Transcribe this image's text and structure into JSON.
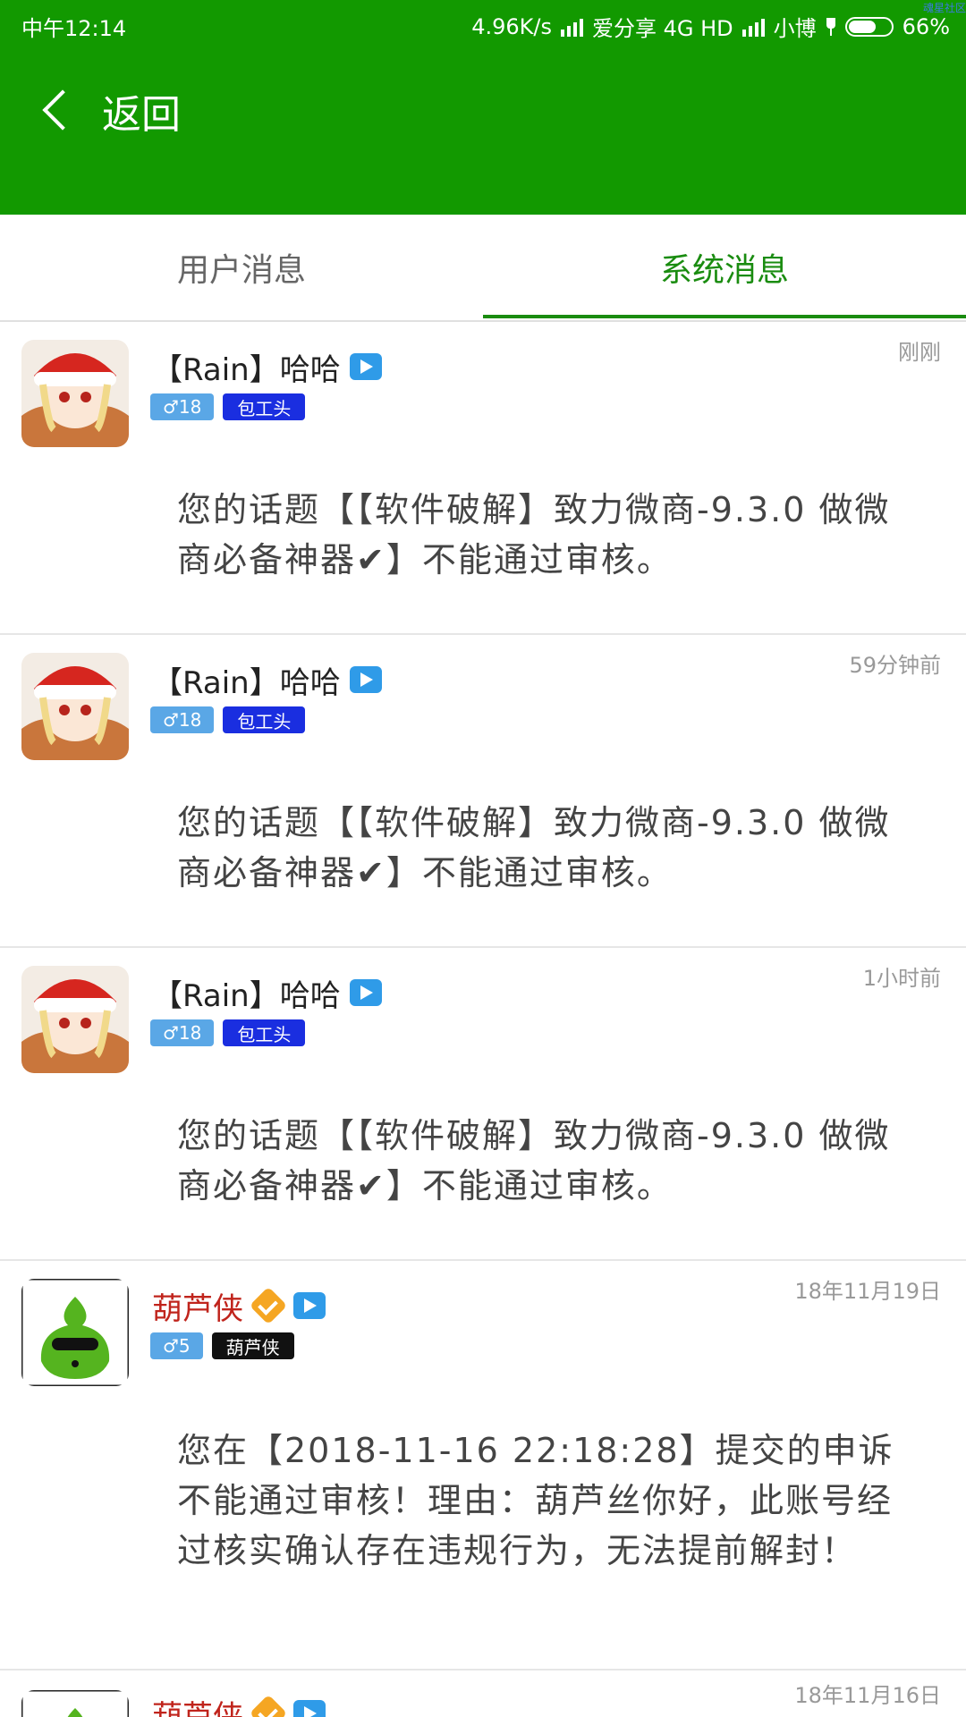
{
  "status_bar": {
    "time": "中午12:14",
    "net_speed": "4.96K/s",
    "carrier1": "爱分享 4G HD",
    "carrier2": "小博",
    "battery": "66%",
    "battery_level": 0.66
  },
  "watermark": "魂星社区",
  "header": {
    "back_label": "返回"
  },
  "tabs": [
    {
      "label": "用户消息",
      "active": false
    },
    {
      "label": "系统消息",
      "active": true
    }
  ],
  "messages": [
    {
      "name": "【Rain】哈哈",
      "gender_level": "♂18",
      "title": "包工头",
      "time": "刚刚",
      "body": "您的话题【【软件破解】致力微商-9.3.0 做微商必备神器✔】不能通过审核。"
    },
    {
      "name": "【Rain】哈哈",
      "gender_level": "♂18",
      "title": "包工头",
      "time": "59分钟前",
      "body": "您的话题【【软件破解】致力微商-9.3.0 做微商必备神器✔】不能通过审核。"
    },
    {
      "name": "【Rain】哈哈",
      "gender_level": "♂18",
      "title": "包工头",
      "time": "1小时前",
      "body": "您的话题【【软件破解】致力微商-9.3.0 做微商必备神器✔】不能通过审核。"
    },
    {
      "name": "葫芦侠",
      "gender_level": "♂5",
      "title": "葫芦侠",
      "time": "18年11月19日",
      "body": "您在【2018-11-16 22:18:28】提交的申诉不能通过审核！理由：葫芦丝你好，此账号经过核实确认存在违规行为，无法提前解封！"
    },
    {
      "name": "葫芦侠",
      "time": "18年11月16日"
    }
  ],
  "colors": {
    "header_green": "#129900",
    "active_tab_green": "#1a8c10",
    "badge_blue": "#1a2ee0",
    "video_blue": "#2f9be8",
    "verified_orange": "#f5a623",
    "official_name_red": "#c0241c"
  }
}
